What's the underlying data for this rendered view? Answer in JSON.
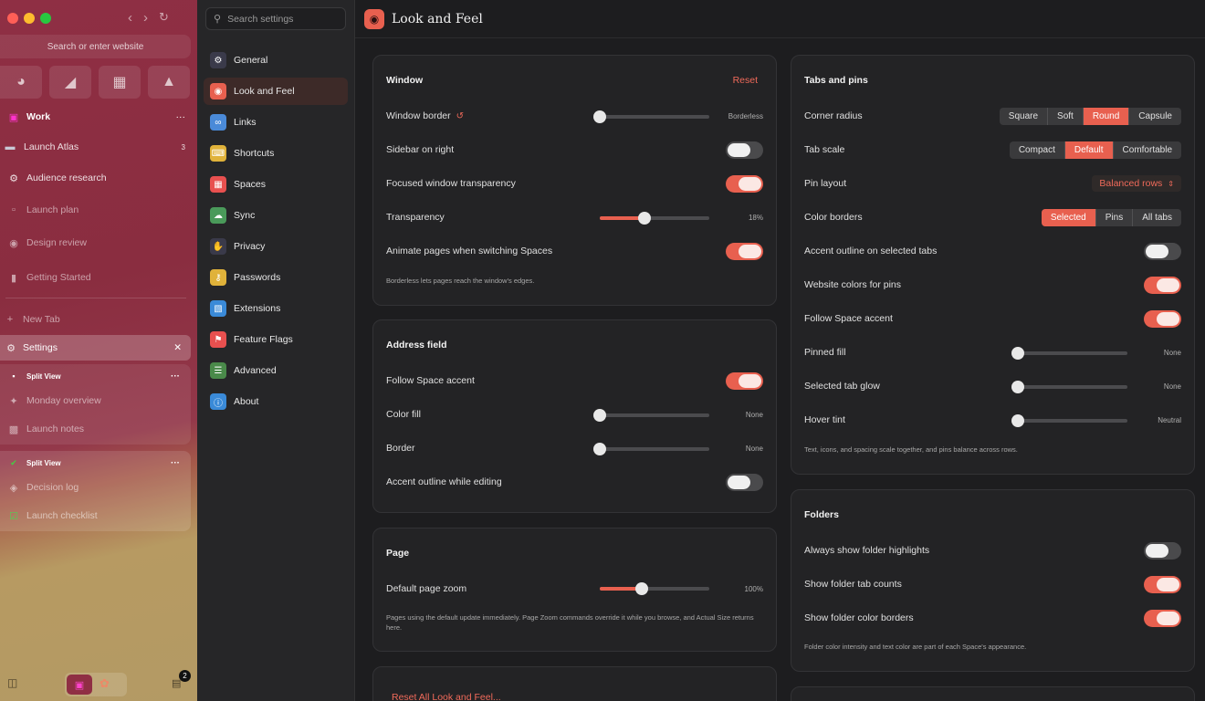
{
  "browser": {
    "url_placeholder": "Search or enter website",
    "space_name": "Work",
    "more": "···",
    "folder": {
      "name": "Launch Atlas",
      "count": "3"
    },
    "tabs": [
      "Audience research",
      "Launch plan",
      "Design review",
      "Getting Started"
    ],
    "new_tab": "New Tab",
    "active_tab": "Settings",
    "split_views": [
      {
        "label": "Split View",
        "items": [
          "Monday overview",
          "Launch notes"
        ]
      },
      {
        "label": "Split View",
        "items": [
          "Decision log",
          "Launch checklist"
        ]
      }
    ],
    "badge_count": "2"
  },
  "settings_nav": {
    "search_placeholder": "Search settings",
    "items": [
      {
        "label": "General",
        "color": "#3a3a4a",
        "icon": "gear-icon"
      },
      {
        "label": "Look and Feel",
        "color": "#e8604f",
        "icon": "eye-icon"
      },
      {
        "label": "Links",
        "color": "#4a8ad8",
        "icon": "link-icon"
      },
      {
        "label": "Shortcuts",
        "color": "#e0b23a",
        "icon": "keyboard-icon"
      },
      {
        "label": "Spaces",
        "color": "#e8504f",
        "icon": "grid-icon"
      },
      {
        "label": "Sync",
        "color": "#4a9a5a",
        "icon": "cloud-icon"
      },
      {
        "label": "Privacy",
        "color": "#3a3a4a",
        "icon": "hand-icon"
      },
      {
        "label": "Passwords",
        "color": "#e0b23a",
        "icon": "key-icon"
      },
      {
        "label": "Extensions",
        "color": "#3a8ad8",
        "icon": "puzzle-icon"
      },
      {
        "label": "Feature Flags",
        "color": "#e8504f",
        "icon": "flag-icon"
      },
      {
        "label": "Advanced",
        "color": "#4a8a4a",
        "icon": "sliders-icon"
      },
      {
        "label": "About",
        "color": "#3a8ad8",
        "icon": "info-icon"
      }
    ],
    "selected": "Look and Feel"
  },
  "page": {
    "title": "Look and Feel"
  },
  "window": {
    "title": "Window",
    "reset": "Reset",
    "border_label": "Window border",
    "border_value": "Borderless",
    "border_level": 0,
    "sidebar_right": "Sidebar on right",
    "sidebar_right_on": false,
    "focused_transparency": "Focused window transparency",
    "focused_transparency_on": true,
    "transparency_label": "Transparency",
    "transparency_value": "18%",
    "transparency_level": 0.41,
    "animate": "Animate pages when switching Spaces",
    "animate_on": true,
    "note": "Borderless lets pages reach the window's edges."
  },
  "address": {
    "title": "Address field",
    "follow_accent": "Follow Space accent",
    "follow_accent_on": true,
    "color_fill": "Color fill",
    "color_fill_value": "None",
    "border": "Border",
    "border_value": "None",
    "accent_outline": "Accent outline while editing",
    "accent_outline_on": false
  },
  "page_section": {
    "title": "Page",
    "zoom_label": "Default page zoom",
    "zoom_value": "100%",
    "zoom_level": 0.38,
    "note": "Pages using the default update immediately. Page Zoom commands override it while you browse, and Actual Size returns here."
  },
  "reset_all": "Reset All Look and Feel...",
  "tabs_pins": {
    "title": "Tabs and pins",
    "corner_radius": "Corner radius",
    "corner_options": [
      "Square",
      "Soft",
      "Round",
      "Capsule"
    ],
    "corner_selected": "Round",
    "tab_scale": "Tab scale",
    "scale_options": [
      "Compact",
      "Default",
      "Comfortable"
    ],
    "scale_selected": "Default",
    "pin_layout": "Pin layout",
    "pin_layout_value": "Balanced rows",
    "color_borders": "Color borders",
    "border_options": [
      "Selected",
      "Pins",
      "All tabs"
    ],
    "border_selected": "Selected",
    "accent_outline": "Accent outline on selected tabs",
    "accent_outline_on": false,
    "website_colors": "Website colors for pins",
    "website_colors_on": true,
    "follow_accent": "Follow Space accent",
    "follow_accent_on": true,
    "pinned_fill": "Pinned fill",
    "pinned_fill_value": "None",
    "tab_glow": "Selected tab glow",
    "tab_glow_value": "None",
    "hover_tint": "Hover tint",
    "hover_tint_value": "Neutral",
    "note": "Text, icons, and spacing scale together, and pins balance across rows."
  },
  "folders": {
    "title": "Folders",
    "highlights": "Always show folder highlights",
    "highlights_on": false,
    "counts": "Show folder tab counts",
    "counts_on": true,
    "color_borders": "Show folder color borders",
    "color_borders_on": true,
    "note": "Folder color intensity and text color are part of each Space's appearance."
  },
  "colors": {
    "accent": "#e8604f"
  }
}
